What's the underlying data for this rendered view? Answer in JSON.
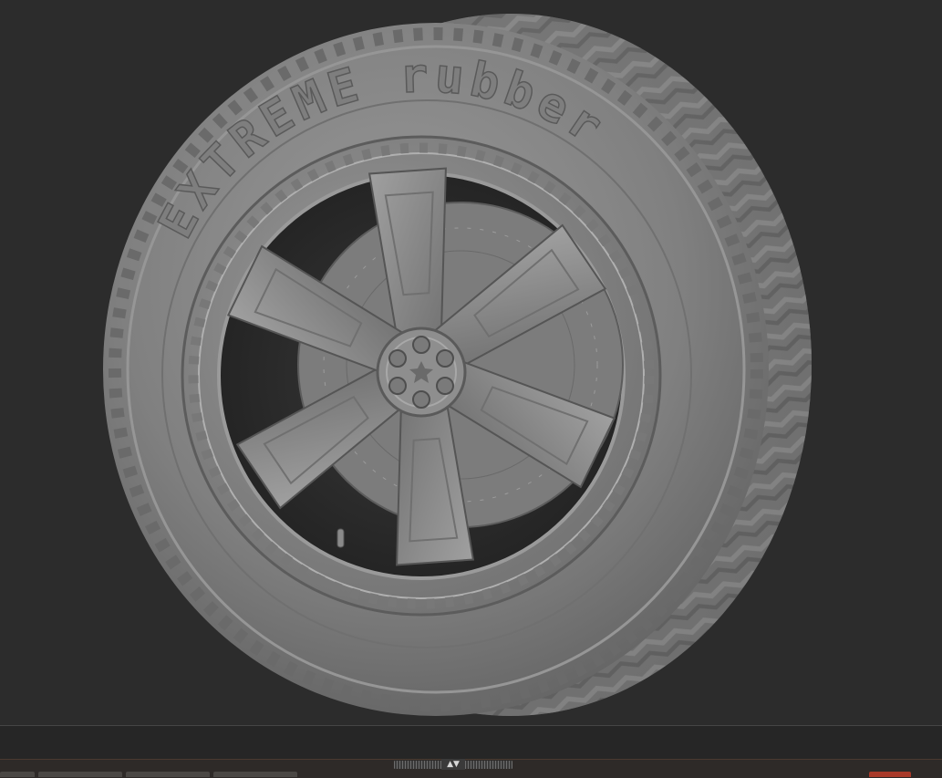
{
  "app": {
    "canvas": {
      "model_name": "wheel",
      "sidewall_text": "EXTREME rubber",
      "background_color": "#2c2c2c",
      "model_color": "#8a8a8a"
    },
    "bottom_tray": {
      "handle_glyph": "▲▼",
      "handle_icon": "collapse-expand-arrows-icon",
      "alert_color": "#a83a2a"
    }
  }
}
